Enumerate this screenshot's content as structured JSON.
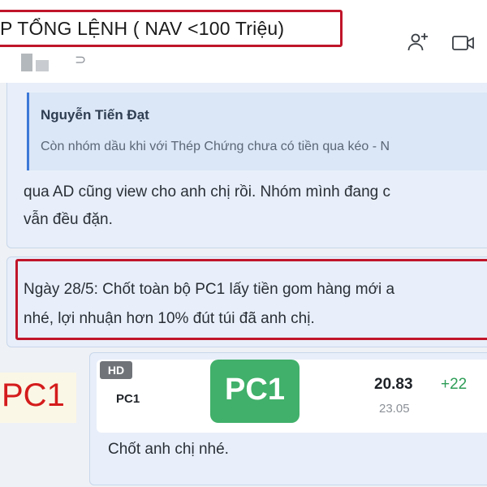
{
  "header": {
    "title": "P TỔNG LỆNH ( NAV <100 Triệu)",
    "sub_icon": "arc-icon",
    "icons": [
      "add-user-icon",
      "video-call-icon"
    ]
  },
  "messages": [
    {
      "quote_author": "Nguyễn Tiến Đạt",
      "quote_text": "Còn nhóm dầu khi với Thép Chứng chưa có tiền qua kéo - N",
      "text_line1": "qua AD cũng view cho anh chị rồi. Nhóm mình đang c",
      "text_line2": "vẫn đều đặn."
    },
    {
      "text_line1": "Ngày 28/5: Chốt toàn bộ PC1 lấy tiền gom hàng mới a",
      "text_line2": "nhé, lợi nhuận hơn 10% đút túi đã anh chị."
    },
    {
      "card": {
        "badge": "HD",
        "symbol": "PC1",
        "logo_text": "PC1",
        "price": "20.83",
        "reference": "23.05",
        "change": "+22"
      },
      "text": "Chốt anh chị nhé."
    }
  ],
  "side_label": "PC1",
  "colors": {
    "highlight_border": "#c0152a",
    "bubble_bg": "#e8effa",
    "quote_bar": "#3c78d8",
    "logo_green": "#41b06a",
    "change_green": "#2e9d57",
    "side_label_red": "#d41c1c"
  }
}
